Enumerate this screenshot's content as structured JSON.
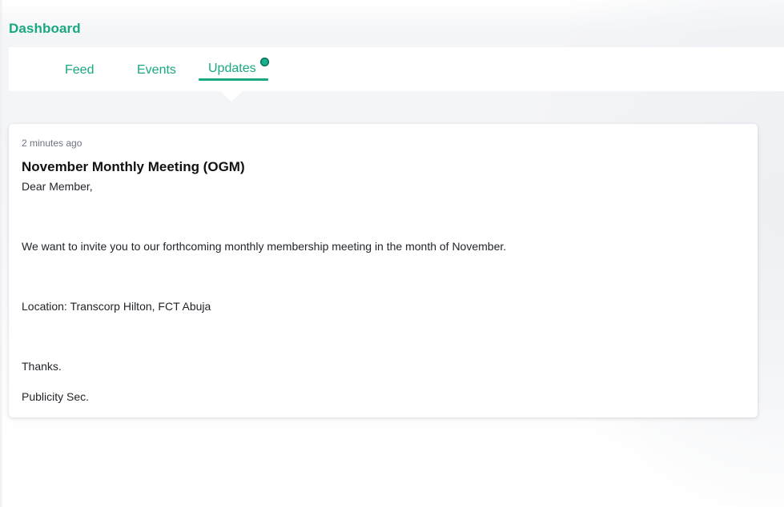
{
  "header": {
    "title": "Dashboard"
  },
  "tabs": [
    {
      "label": "Feed",
      "active": false
    },
    {
      "label": "Events",
      "active": false
    },
    {
      "label": "Updates",
      "active": true,
      "has_notification": true
    }
  ],
  "colors": {
    "accent": "#1aa882",
    "notification_dot": "#16b28f"
  },
  "update": {
    "timestamp": "2 minutes ago",
    "title": "November Monthly Meeting (OGM)",
    "body": [
      "Dear Member,",
      "We want to invite you to our forthcoming monthly membership meeting in the month of November.",
      "Location: Transcorp Hilton, FCT Abuja",
      "Thanks.",
      "Publicity Sec."
    ]
  }
}
